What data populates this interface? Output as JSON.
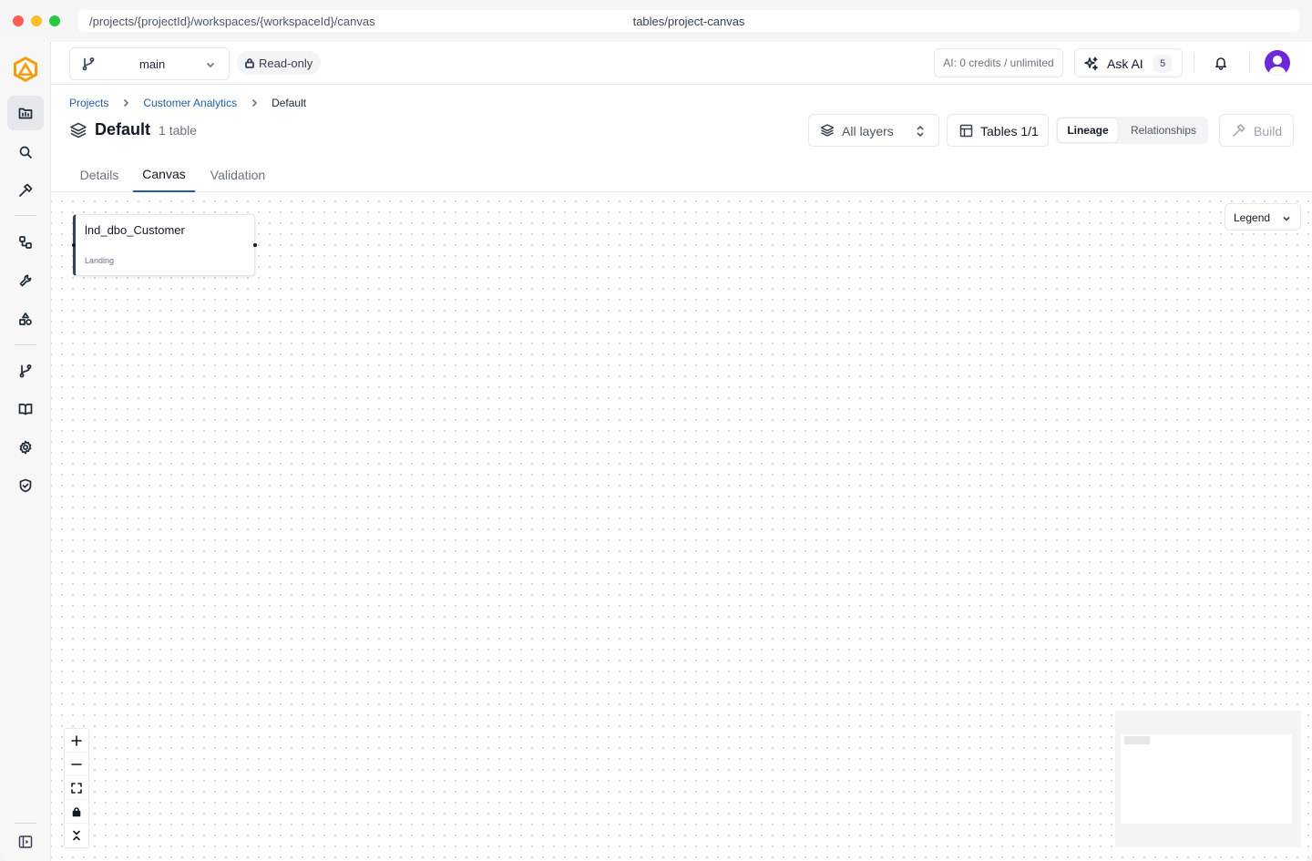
{
  "browser": {
    "url": "/projects/{projectId}/workspaces/{workspaceId}/canvas",
    "route": "tables/project-canvas"
  },
  "sidebar": {
    "items": [
      {
        "name": "projects",
        "icon": "folder-icon",
        "active": true
      },
      {
        "name": "search",
        "icon": "search-icon",
        "active": false
      },
      {
        "name": "build",
        "icon": "hammer-icon",
        "active": false
      },
      {
        "name": "connections",
        "icon": "nodes-icon",
        "active": false
      },
      {
        "name": "tools",
        "icon": "wrench-icon",
        "active": false
      },
      {
        "name": "shapes",
        "icon": "shapes-icon",
        "active": false
      },
      {
        "name": "branches",
        "icon": "git-branch-icon",
        "active": false
      },
      {
        "name": "docs",
        "icon": "book-icon",
        "active": false
      },
      {
        "name": "settings",
        "icon": "gear-icon",
        "active": false
      },
      {
        "name": "security",
        "icon": "shield-icon",
        "active": false
      }
    ]
  },
  "header": {
    "branch": "main",
    "read_only": "Read-only",
    "credits": "AI: 0 credits / unlimited",
    "ask_ai": "Ask AI",
    "ask_ai_count": "5"
  },
  "breadcrumb": {
    "items": [
      "Projects",
      "Customer Analytics"
    ],
    "current": "Default"
  },
  "page": {
    "title": "Default",
    "count": "1 table",
    "layers_select": "All layers",
    "tables_button": "Tables 1/1",
    "view_toggle": {
      "options": [
        "Lineage",
        "Relationships"
      ],
      "selected": "Lineage"
    },
    "build_button": "Build"
  },
  "tabs": {
    "items": [
      "Details",
      "Canvas",
      "Validation"
    ],
    "active": "Canvas"
  },
  "canvas": {
    "legend": "Legend",
    "nodes": [
      {
        "title": "lnd_dbo_Customer",
        "layer": "Landing"
      }
    ],
    "controls": [
      "zoom-in",
      "zoom-out",
      "fit-view",
      "lock",
      "collapse"
    ]
  },
  "colors": {
    "accent": "#1f5fa8",
    "logo": "#f59e0b",
    "avatar": "#6d28d9"
  }
}
